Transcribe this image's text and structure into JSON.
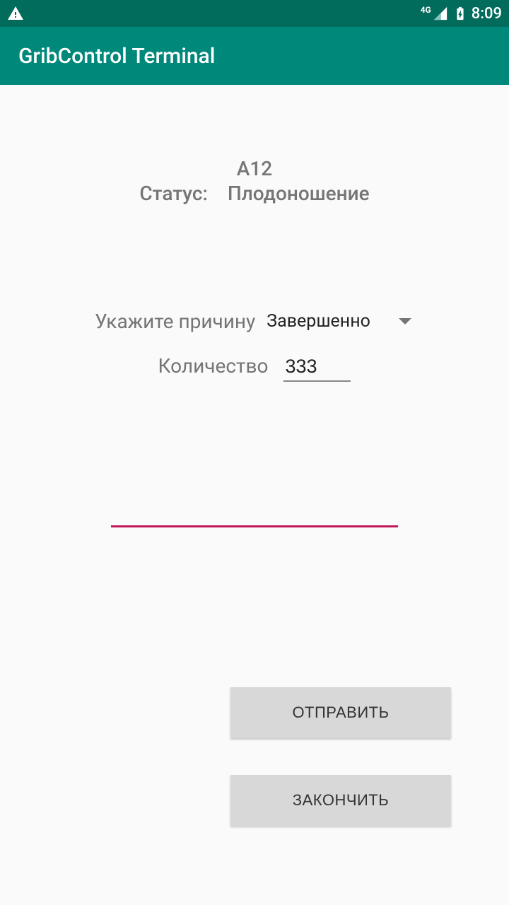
{
  "statusbar": {
    "time": "8:09",
    "network": "4G"
  },
  "appbar": {
    "title": "GribControl Terminal"
  },
  "info": {
    "code": "А12",
    "status_label": "Статус:",
    "status_value": "Плодоношение"
  },
  "form": {
    "reason_label": "Укажите причину",
    "reason_value": "Завершенно",
    "qty_label": "Количество",
    "qty_value": "333",
    "text_value": ""
  },
  "buttons": {
    "send": "ОТПРАВИТЬ",
    "finish": "ЗАКОНЧИТЬ"
  }
}
